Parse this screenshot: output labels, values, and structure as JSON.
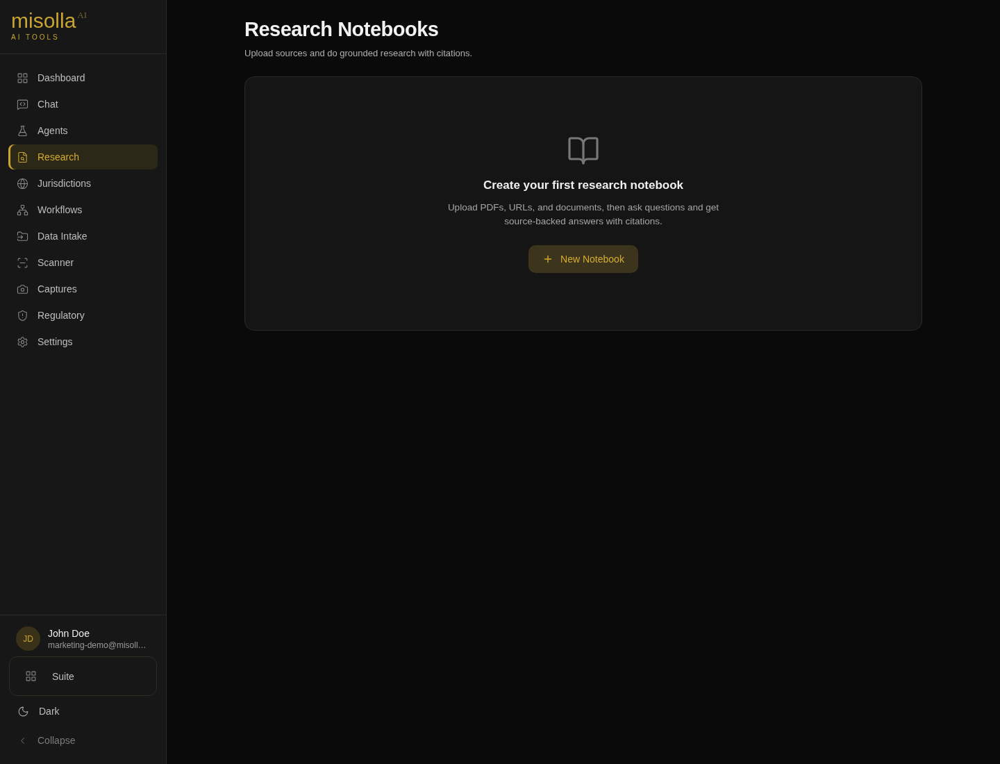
{
  "sidebar": {
    "logo": {
      "name": "misolla",
      "badge": "AI",
      "tagline": "AI TOOLS"
    },
    "items": [
      {
        "label": "Dashboard",
        "selected": false
      },
      {
        "label": "Chat",
        "selected": false
      },
      {
        "label": "Agents",
        "selected": false
      },
      {
        "label": "Research",
        "selected": true
      },
      {
        "label": "Jurisdictions",
        "selected": false
      },
      {
        "label": "Workflows",
        "selected": false
      },
      {
        "label": "Data Intake",
        "selected": false
      },
      {
        "label": "Scanner",
        "selected": false
      },
      {
        "label": "Captures",
        "selected": false
      },
      {
        "label": "Regulatory",
        "selected": false
      },
      {
        "label": "Settings",
        "selected": false
      }
    ],
    "user": {
      "initials": "JD",
      "name": "John Doe",
      "email": "marketing-demo@misoll…"
    },
    "suite": "Suite",
    "theme": "Dark",
    "collapse": "Collapse"
  },
  "page": {
    "title": "Research Notebooks",
    "subtitle": "Upload sources and do grounded research with citations.",
    "empty_state": {
      "title": "Create your first research notebook",
      "text": "Upload PDFs, URLs, and documents, then ask questions and get source-backed answers with citations.",
      "button": "New Notebook"
    }
  }
}
